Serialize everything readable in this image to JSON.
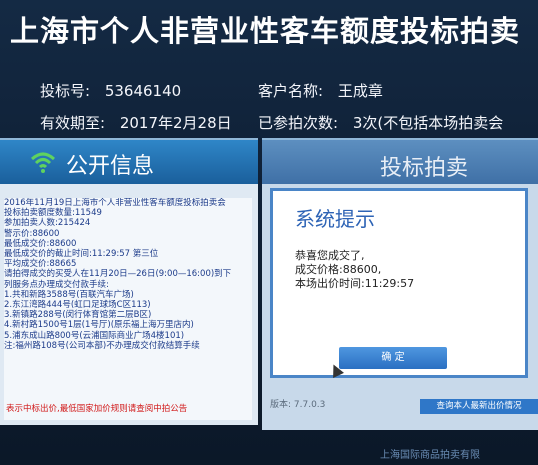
{
  "header": {
    "title": "上海市个人非营业性客车额度投标拍卖",
    "bid_no_label": "投标号:",
    "bid_no": "53646140",
    "customer_label": "客户名称:",
    "customer": "王成章",
    "valid_label": "有效期至:",
    "valid_date": "2017年2月28日",
    "attempts_label": "已参拍次数:",
    "attempts": "3次(不包括本场拍卖会"
  },
  "left_panel": {
    "title": "公开信息",
    "lines": [
      "2016年11月19日上海市个人非营业性客车额度投标拍卖会",
      "投标拍卖额度数量:11549",
      "参加拍卖人数:215424",
      "警示价:88600",
      "最低成交价:88600",
      "最低成交价的截止时间:11:29:57 第三位",
      "平均成交价:88665",
      "请拍得成交的买受人在11月20日—26日(9:00—16:00)到下",
      "列服务点办理成交付款手续:",
      "1.共和新路3588号(百联汽车广场)",
      "2.东江湾路444号(虹口足球场C区113)",
      "3.新镇路288号(闵行体育馆第二层B区)",
      "4.新村路1500号1层(1号厅)(原乐福上海万里店内)",
      "5.浦东成山路800号(云浦国际商业广场4楼101)",
      "注:福州路108号(公司本部)不办理成交付款结算手续"
    ],
    "red_note": "表示中标出价,最低国家加价规则请查阅中拍公告"
  },
  "right_panel": {
    "title": "投标拍卖",
    "dialog": {
      "title": "系统提示",
      "line1": "恭喜您成交了,",
      "line2": "成交价格:88600,",
      "line3": "本场出价时间:11:29:57",
      "ok_label": "确 定"
    },
    "version": "版本: 7.7.0.3",
    "query_label": "查询本人最新出价情况"
  },
  "footer": "上海国际商品拍卖有限"
}
